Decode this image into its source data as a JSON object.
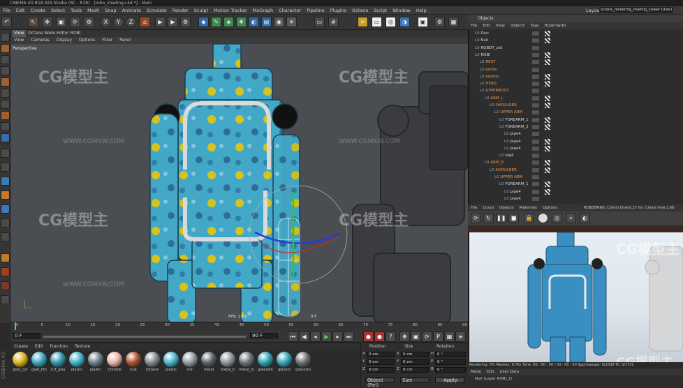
{
  "app": {
    "title": "CINEMA 4D R18.029 Studio (RC - R18) - [robo_shading.c4d *] - Main",
    "layout_label": "Layout:",
    "layout_value": "octane_rendering_shading_viewer (User)"
  },
  "menubar": [
    "File",
    "Edit",
    "Create",
    "Select",
    "Tools",
    "Mesh",
    "Snap",
    "Animate",
    "Simulate",
    "Render",
    "Sculpt",
    "Motion Tracker",
    "MoGraph",
    "Character",
    "Pipeline",
    "Plugins",
    "Octane",
    "Script",
    "Window",
    "Help"
  ],
  "toolbar": {
    "axis": [
      "X",
      "Y",
      "Z"
    ]
  },
  "viewport": {
    "tab_view": "View",
    "tab_octane": "Octane Node Editor ROBI",
    "menu": [
      "View",
      "Cameras",
      "Display",
      "Options",
      "Filter",
      "Panel"
    ],
    "label": "Perspective",
    "fps": "FPS: 13.9",
    "frame": "0 F"
  },
  "timeline": {
    "ticks": [
      "0",
      "5",
      "10",
      "15",
      "20",
      "25",
      "30",
      "35",
      "40",
      "45",
      "50",
      "55",
      "60",
      "65",
      "70",
      "75",
      "80",
      "85",
      "90"
    ],
    "current": "0 F",
    "end": "90 F",
    "start_field": "0 F",
    "end_field": "90 F"
  },
  "materials": {
    "menu": [
      "Create",
      "Edit",
      "Function",
      "Texture"
    ],
    "items": [
      {
        "label": "gost_cor",
        "color": "#d8b418"
      },
      {
        "label": "goat_lith",
        "color": "#3aa6c0"
      },
      {
        "label": "d.ff_plas",
        "color": "#2f97b0"
      },
      {
        "label": "plastic",
        "color": "#3db3c9"
      },
      {
        "label": "plastic",
        "color": "#6d7f8c"
      },
      {
        "label": "Chrome",
        "color": "#e9b3a6"
      },
      {
        "label": "rust",
        "color": "#a8532a"
      },
      {
        "label": "Octane",
        "color": "#7f8a90"
      },
      {
        "label": "plastic",
        "color": "#49b5cc"
      },
      {
        "label": "mir",
        "color": "#909a9e"
      },
      {
        "label": "metal",
        "color": "#5c6368"
      },
      {
        "label": "metal_b",
        "color": "#8d9396"
      },
      {
        "label": "metal_m",
        "color": "#6b7378"
      },
      {
        "label": "greenish",
        "color": "#2ba0b2"
      },
      {
        "label": "glazoid",
        "color": "#34a3b6"
      },
      {
        "label": "greenish",
        "color": "#6a7175"
      }
    ]
  },
  "coordinates": {
    "headers": [
      "Position",
      "Size",
      "Rotation"
    ],
    "rows": [
      {
        "axis": "X",
        "pos": "0 cm",
        "size": "0 cm",
        "rot_axis": "H",
        "rot": "0 °"
      },
      {
        "axis": "Y",
        "pos": "0 cm",
        "size": "0 cm",
        "rot_axis": "P",
        "rot": "0 °"
      },
      {
        "axis": "Z",
        "pos": "0 cm",
        "size": "0 cm",
        "rot_axis": "B",
        "rot": "0 °"
      }
    ],
    "mode": "Object (Rel)",
    "size_mode": "Size",
    "apply": "Apply"
  },
  "objects": {
    "title": "Objects",
    "menu": [
      "File",
      "Edit",
      "View",
      "Objects",
      "Tags",
      "Bookmarks"
    ],
    "tree": [
      {
        "indent": 0,
        "name": "Disc"
      },
      {
        "indent": 0,
        "name": "Null"
      },
      {
        "indent": 0,
        "name": "ROBOT_old"
      },
      {
        "indent": 0,
        "name": "ROBI"
      },
      {
        "indent": 1,
        "name": "REST"
      },
      {
        "indent": 1,
        "name": "entire"
      },
      {
        "indent": 1,
        "name": "engine"
      },
      {
        "indent": 1,
        "name": "HEAD"
      },
      {
        "indent": 1,
        "name": "UPPERBODY"
      },
      {
        "indent": 2,
        "name": "ARM_L"
      },
      {
        "indent": 3,
        "name": "SHOULDER"
      },
      {
        "indent": 4,
        "name": "UPPER ARM"
      },
      {
        "indent": 5,
        "name": "FOREARM_1"
      },
      {
        "indent": 5,
        "name": "FOREARM_2"
      },
      {
        "indent": 6,
        "name": "pipe4"
      },
      {
        "indent": 6,
        "name": "pipe4"
      },
      {
        "indent": 6,
        "name": "pipe4"
      },
      {
        "indent": 5,
        "name": "obj4"
      },
      {
        "indent": 2,
        "name": "ARM_R"
      },
      {
        "indent": 3,
        "name": "SHOULDER"
      },
      {
        "indent": 4,
        "name": "UPPER ARM"
      },
      {
        "indent": 5,
        "name": "FOREARM_1"
      },
      {
        "indent": 6,
        "name": "pipe4"
      },
      {
        "indent": 6,
        "name": "pipe4"
      }
    ]
  },
  "render": {
    "menu": [
      "File",
      "Cloud",
      "Objects",
      "Materials",
      "Options"
    ],
    "status_text": "RENDERING: Collect time:0.17 ms.  Check here:1.68",
    "progress_text": "Rendering: 0%  Meshes: 9.70s  Time: 00 : 00 : 00 / 00 : 00 : 00  Spp/maxspp: 0/1000  Tri: 0/1731",
    "bottom_menu": [
      "Mode",
      "Edit",
      "User Data"
    ],
    "bottom_item": "Null (Layer ROBI_1)"
  },
  "watermarks": {
    "brand": "CG模型主",
    "url": "WWW.CGMXW.COM"
  },
  "side_label": "CINEMA 4D",
  "colors": {
    "accent_orange": "#e58a3a",
    "robot_blue": "#43a8c8",
    "robot_yellow": "#d8c31b",
    "viewport_bg": "#4a4d52"
  }
}
